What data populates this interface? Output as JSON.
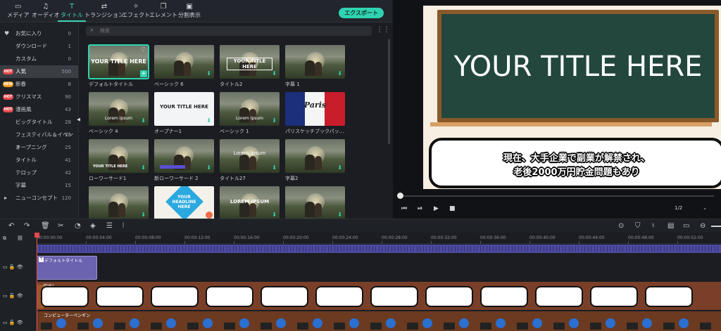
{
  "toolbar": {
    "tabs": [
      {
        "label": "メディア",
        "icon": "folder-icon"
      },
      {
        "label": "オーディオ",
        "icon": "music-note-icon"
      },
      {
        "label": "タイトル",
        "icon": "text-t-icon"
      },
      {
        "label": "トランジション",
        "icon": "transition-icon"
      },
      {
        "label": "エフェクト",
        "icon": "sparkle-icon"
      },
      {
        "label": "エレメント",
        "icon": "element-icon"
      },
      {
        "label": "分割表示",
        "icon": "split-screen-icon"
      }
    ],
    "active_tab": "タイトル",
    "export_label": "エクスポート",
    "accent_color": "#2fd3b1"
  },
  "sidebar": {
    "items": [
      {
        "label": "お気に入り",
        "count": "0"
      },
      {
        "label": "ダウンロード",
        "count": "1"
      },
      {
        "label": "カスタム",
        "count": "0"
      },
      {
        "label": "人気",
        "count": "500",
        "badge": "HOT"
      },
      {
        "label": "新春",
        "count": "8",
        "badge": "NEW"
      },
      {
        "label": "クリスマス",
        "count": "90",
        "badge": "HOT"
      },
      {
        "label": "漫画風",
        "count": "43",
        "badge": "HOT"
      },
      {
        "label": "ビッグタイトル",
        "count": "28"
      },
      {
        "label": "フェスティバル＆イベント",
        "count": "28"
      },
      {
        "label": "オープニング",
        "count": "25"
      },
      {
        "label": "タイトル",
        "count": "41"
      },
      {
        "label": "テロップ",
        "count": "42"
      },
      {
        "label": "字幕",
        "count": "15"
      },
      {
        "label": "ニューコンセプト",
        "count": "120"
      }
    ],
    "selected": "人気"
  },
  "browser": {
    "search_placeholder": "検索",
    "cards": [
      {
        "label": "デフォルトタイトル",
        "thumb_text": "YOUR TITLE HERE"
      },
      {
        "label": "ベーシック 6",
        "thumb_text": ""
      },
      {
        "label": "タイトル2",
        "thumb_text": "YOUR TITLE HERE"
      },
      {
        "label": "字幕 1",
        "thumb_text": ""
      },
      {
        "label": "ベーシック 4",
        "thumb_text": "Lorem Ipsum"
      },
      {
        "label": "オープナー1",
        "thumb_text": "YOUR TITLE HERE"
      },
      {
        "label": "ベーシック 1",
        "thumb_text": "Lorem Ipsum"
      },
      {
        "label": "パリスケッチブックパック タイト...",
        "thumb_text": "Paris"
      },
      {
        "label": "ローワーサード1",
        "thumb_text": "YOUR TITLE HERE"
      },
      {
        "label": "新ローワーサード 2",
        "thumb_text": ""
      },
      {
        "label": "タイトル27",
        "thumb_text": "Lorem Ipsum"
      },
      {
        "label": "字幕2",
        "thumb_text": ""
      },
      {
        "label": "",
        "thumb_text": ""
      },
      {
        "label": "",
        "thumb_text": "YOUR HEADLINE HERE"
      },
      {
        "label": "",
        "thumb_text": "LOREM IPSUM"
      },
      {
        "label": "",
        "thumb_text": ""
      }
    ]
  },
  "preview": {
    "title_text": "YOUR TITLE HERE",
    "caption_line1": "現在、大手企業で副業が解禁され、",
    "caption_line2": "老後2000万円貯金問題もあり",
    "ratio": "1/2"
  },
  "timeline": {
    "ticks": [
      "00:00:00:00",
      "00:00:04:00",
      "00:00:08:00",
      "00:00:12:00",
      "00:00:16:00",
      "00:00:20:00",
      "00:00:24:00",
      "00:00:28:00",
      "00:00:32:00",
      "00:00:36:00",
      "00:00:40:00",
      "00:00:44:00",
      "00:00:48:00",
      "00:00:52:00"
    ],
    "title_clip_label": "デフォルトタイトル",
    "bubble_clip_label": "吹出し",
    "char_clip_label": "コンピューターペンギン"
  }
}
